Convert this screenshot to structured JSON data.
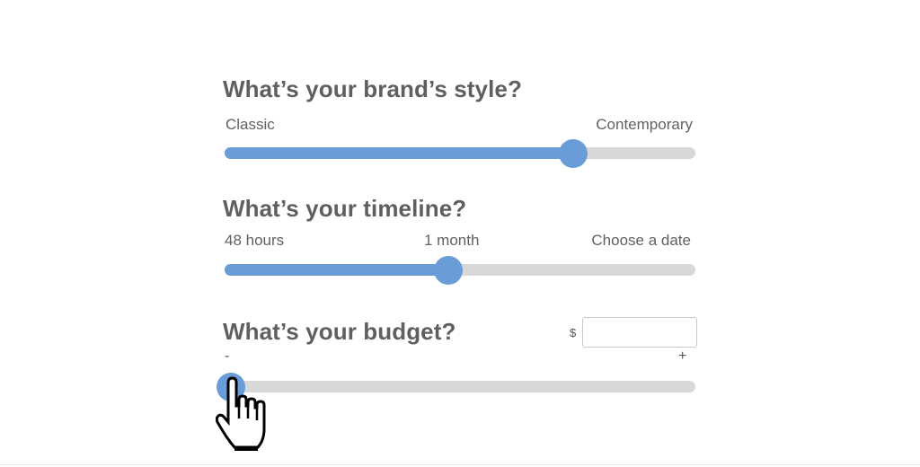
{
  "style_question": {
    "title": "What’s your brand’s style?",
    "min_label": "Classic",
    "max_label": "Contemporary",
    "value_fraction": 0.74
  },
  "timeline_question": {
    "title": "What’s your timeline?",
    "labels": [
      "48 hours",
      "1 month",
      "Choose a date"
    ],
    "value_fraction": 0.475
  },
  "budget_question": {
    "title": "What’s your budget?",
    "currency_symbol": "$",
    "input_value": "",
    "input_placeholder": "",
    "min_label": "-",
    "max_label": "+",
    "value_fraction": 0.013
  },
  "colors": {
    "accent": "#6a9dd8",
    "track": "#d8d8d8",
    "heading": "#5f5f5f"
  },
  "cursor_icon": "hand-pointer-icon"
}
